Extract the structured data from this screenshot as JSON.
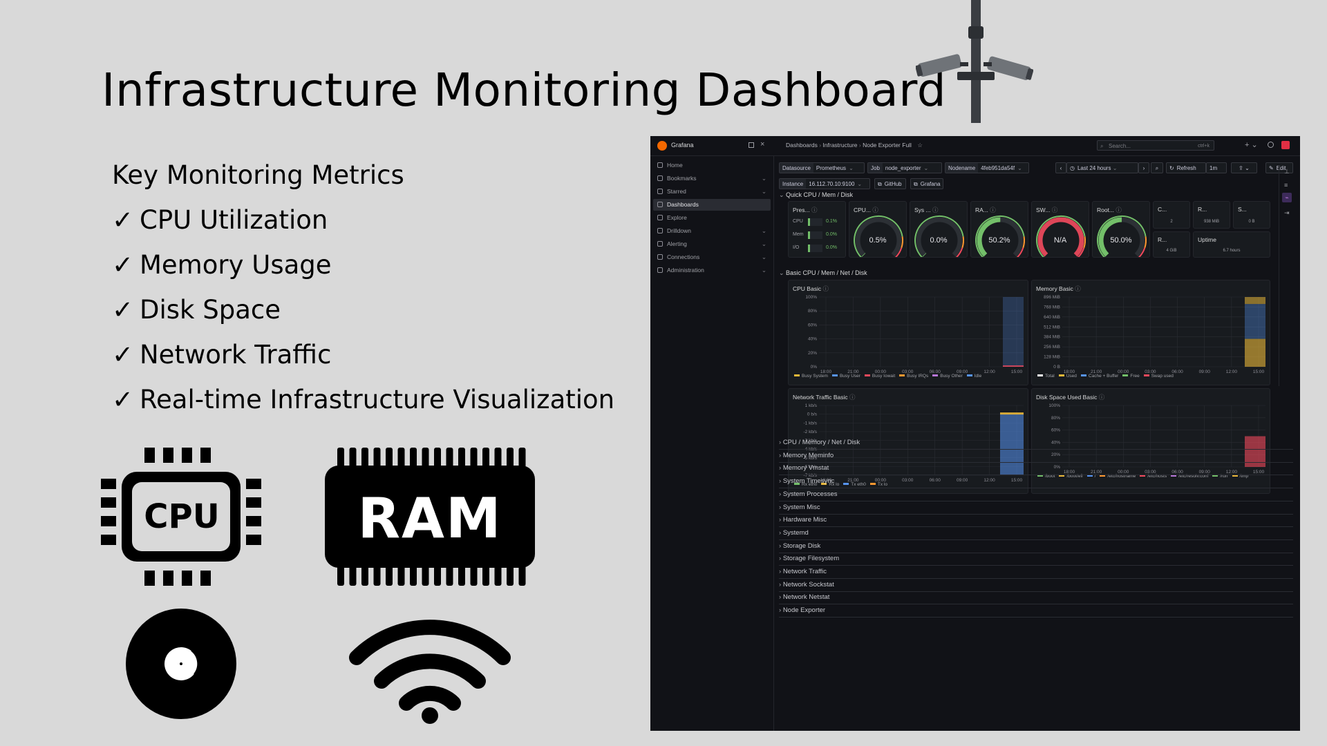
{
  "slide": {
    "title": "Infrastructure Monitoring Dashboard",
    "metrics_heading": "Key Monitoring Metrics",
    "check": "✓",
    "metrics": [
      "CPU Utilization",
      "Memory Usage",
      "Disk Space",
      "Network Traffic",
      "Real-time Infrastructure Visualization"
    ],
    "cpu_icon_label": "CPU",
    "ram_icon_label": "RAM"
  },
  "grafana": {
    "brand": "Grafana",
    "breadcrumb": [
      "Dashboards",
      "Infrastructure",
      "Node Exporter Full"
    ],
    "search_placeholder": "Search...",
    "search_shortcut": "ctrl+k",
    "sidebar": [
      {
        "label": "Home",
        "icon": "home-icon",
        "chevron": false
      },
      {
        "label": "Bookmarks",
        "icon": "bookmark-icon",
        "chevron": true
      },
      {
        "label": "Starred",
        "icon": "star-icon",
        "chevron": true
      },
      {
        "label": "Dashboards",
        "icon": "grid-icon",
        "chevron": false,
        "active": true
      },
      {
        "label": "Explore",
        "icon": "compass-icon",
        "chevron": false
      },
      {
        "label": "Drilldown",
        "icon": "drilldown-icon",
        "chevron": true
      },
      {
        "label": "Alerting",
        "icon": "bell-icon",
        "chevron": true
      },
      {
        "label": "Connections",
        "icon": "plug-icon",
        "chevron": true
      },
      {
        "label": "Administration",
        "icon": "gear-icon",
        "chevron": true
      }
    ],
    "vars": {
      "datasource_label": "Datasource",
      "datasource": "Prometheus",
      "job_label": "Job",
      "job": "node_exporter",
      "nodename_label": "Nodename",
      "nodename": "4feb951da54f",
      "instance_label": "Instance",
      "instance": "16.112.70.10:9100",
      "link_github": "GitHub",
      "link_grafana": "Grafana"
    },
    "toolbar": {
      "time_range": "Last 24 hours",
      "refresh": "Refresh",
      "interval": "1m",
      "edit": "Edit"
    },
    "rows": {
      "quick": "Quick CPU / Mem / Disk",
      "basic": "Basic CPU / Mem / Net / Disk"
    },
    "pressure": {
      "title": "Pres...",
      "rows": [
        {
          "label": "CPU",
          "value": "0.1%"
        },
        {
          "label": "Mem",
          "value": "0.0%"
        },
        {
          "label": "I/O",
          "value": "0.0%"
        }
      ]
    },
    "gauges": [
      {
        "title": "CPU...",
        "value": "0.5%",
        "fraction": 0.005,
        "color": "#73bf69"
      },
      {
        "title": "Sys ...",
        "value": "0.0%",
        "fraction": 0.0,
        "color": "#73bf69"
      },
      {
        "title": "RA...",
        "value": "50.2%",
        "fraction": 0.502,
        "color": "#73bf69"
      },
      {
        "title": "SW...",
        "value": "N/A",
        "fraction": 0.0,
        "color": "#f2495c"
      },
      {
        "title": "Root...",
        "value": "50.0%",
        "fraction": 0.5,
        "color": "#73bf69"
      }
    ],
    "small_stats": [
      {
        "title": "C...",
        "value": "2"
      },
      {
        "title": "R...",
        "value": "938 MiB"
      },
      {
        "title": "S...",
        "value": "0 B"
      },
      {
        "title": "R...",
        "value": "4 GiB"
      },
      {
        "title": "Uptime",
        "value": "6.7 hours"
      }
    ],
    "collapsed_rows": [
      "CPU / Memory / Net / Disk",
      "Memory Meminfo",
      "Memory Vmstat",
      "System Timesync",
      "System Processes",
      "System Misc",
      "Hardware Misc",
      "Systemd",
      "Storage Disk",
      "Storage Filesystem",
      "Network Traffic",
      "Network Sockstat",
      "Network Netstat",
      "Node Exporter"
    ]
  },
  "chart_data": [
    {
      "type": "area",
      "title": "CPU Basic",
      "x": [
        "18:00",
        "21:00",
        "00:00",
        "03:00",
        "06:00",
        "09:00",
        "12:00",
        "15:00"
      ],
      "y_ticks": [
        "100%",
        "80%",
        "60%",
        "40%",
        "20%",
        "0%"
      ],
      "ylim": [
        0,
        100
      ],
      "series": [
        {
          "name": "Busy System",
          "color": "#eab839"
        },
        {
          "name": "Busy User",
          "color": "#5794f2"
        },
        {
          "name": "Busy Iowait",
          "color": "#f2495c"
        },
        {
          "name": "Busy IRQs",
          "color": "#ff9830"
        },
        {
          "name": "Busy Other",
          "color": "#b877d9"
        },
        {
          "name": "Idle",
          "color": "#5794f2"
        }
      ]
    },
    {
      "type": "area",
      "title": "Memory Basic",
      "x": [
        "18:00",
        "21:00",
        "00:00",
        "03:00",
        "06:00",
        "09:00",
        "12:00",
        "15:00"
      ],
      "y_ticks": [
        "896 MiB",
        "768 MiB",
        "640 MiB",
        "512 MiB",
        "384 MiB",
        "256 MiB",
        "128 MiB",
        "0 B"
      ],
      "series": [
        {
          "name": "Total",
          "color": "#ffffff"
        },
        {
          "name": "Used",
          "color": "#eab839"
        },
        {
          "name": "Cache + Buffer",
          "color": "#5794f2"
        },
        {
          "name": "Free",
          "color": "#73bf69"
        },
        {
          "name": "Swap used",
          "color": "#f2495c"
        }
      ]
    },
    {
      "type": "area",
      "title": "Network Traffic Basic",
      "x": [
        "18:00",
        "21:00",
        "00:00",
        "03:00",
        "06:00",
        "09:00",
        "12:00",
        "15:00"
      ],
      "y_ticks": [
        "1 kb/s",
        "0 b/s",
        "-1 kb/s",
        "-2 kb/s",
        "-3 kb/s",
        "-4 kb/s",
        "-5 kb/s",
        "-6 kb/s",
        "-7 kb/s"
      ],
      "series": [
        {
          "name": "Rx eth0",
          "color": "#73bf69"
        },
        {
          "name": "Rx lo",
          "color": "#eab839"
        },
        {
          "name": "Tx eth0",
          "color": "#5794f2"
        },
        {
          "name": "Tx lo",
          "color": "#ff9830"
        }
      ]
    },
    {
      "type": "area",
      "title": "Disk Space Used Basic",
      "x": [
        "18:00",
        "21:00",
        "00:00",
        "03:00",
        "06:00",
        "09:00",
        "12:00",
        "15:00"
      ],
      "y_ticks": [
        "100%",
        "80%",
        "60%",
        "40%",
        "20%",
        "0%"
      ],
      "ylim": [
        0,
        100
      ],
      "series": [
        {
          "name": "/boot",
          "color": "#73bf69"
        },
        {
          "name": "/boot/efi",
          "color": "#eab839"
        },
        {
          "name": "/",
          "color": "#5794f2"
        },
        {
          "name": "/etc/hostname",
          "color": "#ff9830"
        },
        {
          "name": "/etc/hosts",
          "color": "#f2495c"
        },
        {
          "name": "/etc/resolv.conf",
          "color": "#b877d9"
        },
        {
          "name": "/run",
          "color": "#73bf69"
        },
        {
          "name": "/tmp",
          "color": "#eab839"
        }
      ]
    }
  ]
}
